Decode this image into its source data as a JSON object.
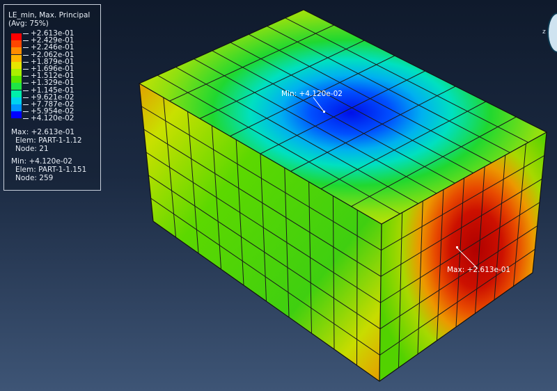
{
  "legend": {
    "title": "LE_min, Max. Principal",
    "avg": "(Avg: 75%)",
    "levels": [
      {
        "value": "+2.613e-01",
        "color": "#ff0000"
      },
      {
        "value": "+2.429e-01",
        "color": "#ff4600"
      },
      {
        "value": "+2.246e-01",
        "color": "#ff8c00"
      },
      {
        "value": "+2.062e-01",
        "color": "#ffb400"
      },
      {
        "value": "+1.879e-01",
        "color": "#e6e600"
      },
      {
        "value": "+1.696e-01",
        "color": "#aaf000"
      },
      {
        "value": "+1.512e-01",
        "color": "#5ae600"
      },
      {
        "value": "+1.329e-01",
        "color": "#1ee646"
      },
      {
        "value": "+1.145e-01",
        "color": "#00f0aa"
      },
      {
        "value": "+9.621e-02",
        "color": "#00d2f0"
      },
      {
        "value": "+7.787e-02",
        "color": "#0096ff"
      },
      {
        "value": "+5.954e-02",
        "color": "#0046ff"
      },
      {
        "value": "+4.120e-02",
        "color": "#0000ff"
      }
    ],
    "max_line": "Max: +2.613e-01",
    "max_elem": "Elem: PART-1-1.12",
    "max_node": "Node: 21",
    "min_line": "Min: +4.120e-02",
    "min_elem": "Elem: PART-1-1.151",
    "min_node": "Node: 259"
  },
  "markers": {
    "min_label": "Min: +4.120e-02",
    "max_label": "Max: +2.613e-01"
  },
  "triad": {
    "axis_label": "z"
  }
}
